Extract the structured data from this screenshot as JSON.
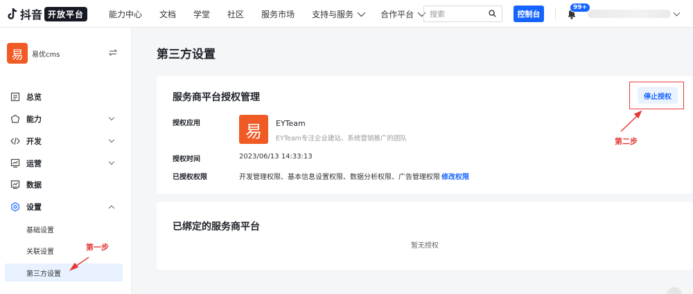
{
  "topbar": {
    "logo_text": "抖音",
    "logo_pill": "开放平台",
    "nav": [
      {
        "label": "能力中心",
        "dropdown": false
      },
      {
        "label": "文档",
        "dropdown": false
      },
      {
        "label": "学堂",
        "dropdown": false
      },
      {
        "label": "社区",
        "dropdown": false
      },
      {
        "label": "服务市场",
        "dropdown": false
      },
      {
        "label": "支持与服务",
        "dropdown": true
      },
      {
        "label": "合作平台",
        "dropdown": true
      }
    ],
    "search_placeholder": "搜索",
    "console_label": "控制台",
    "notif_badge": "99+"
  },
  "sidebar": {
    "app_name": "易优cms",
    "app_avatar_char": "易",
    "items": [
      {
        "label": "总览",
        "icon": "dashboard-icon",
        "expandable": false
      },
      {
        "label": "能力",
        "icon": "capability-icon",
        "expandable": true
      },
      {
        "label": "开发",
        "icon": "code-icon",
        "expandable": true
      },
      {
        "label": "运营",
        "icon": "operation-icon",
        "expandable": true
      },
      {
        "label": "数据",
        "icon": "data-icon",
        "expandable": false
      },
      {
        "label": "设置",
        "icon": "settings-icon",
        "expandable": true,
        "expanded": true
      }
    ],
    "sub_items": [
      {
        "label": "基础设置",
        "active": false
      },
      {
        "label": "关联设置",
        "active": false
      },
      {
        "label": "第三方设置",
        "active": true
      }
    ]
  },
  "main": {
    "page_title": "第三方设置",
    "auth_card": {
      "title": "服务商平台授权管理",
      "stop_label": "停止授权",
      "app_label": "授权应用",
      "app_avatar_char": "易",
      "app_name": "EYTeam",
      "app_desc": "EYTeam专注企业建站、系统营销推广的团队",
      "time_label": "授权时间",
      "time_value": "2023/06/13 14:33:13",
      "perm_label": "已授权权限",
      "perm_value": "开发管理权限、基本信息设置权限、数据分析权限、广告管理权限",
      "perm_edit": "修改权限"
    },
    "bound_card": {
      "title": "已绑定的服务商平台",
      "empty": "暂无授权"
    }
  },
  "annotations": {
    "step1": "第一步",
    "step2": "第二步",
    "color": "#e53935"
  },
  "colors": {
    "brand_blue": "#1664ff",
    "app_orange": "#f05a24",
    "active_bg": "#e8f1ff"
  }
}
